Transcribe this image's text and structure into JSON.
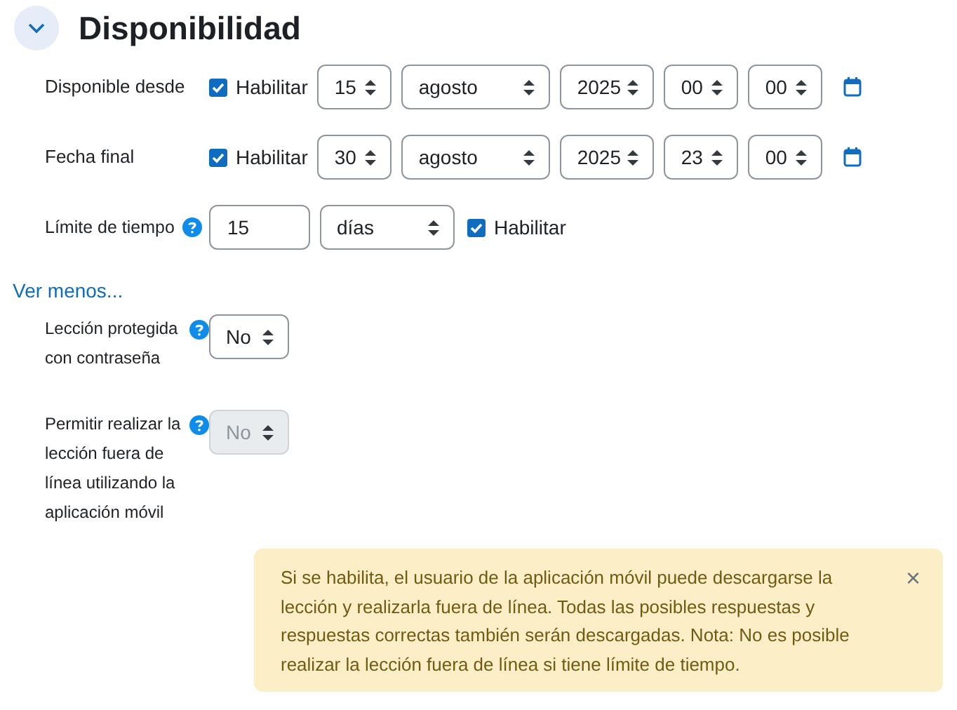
{
  "section": {
    "title": "Disponibilidad",
    "expanded": true
  },
  "date_rows": [
    {
      "label": "Disponible desde",
      "enable_label": "Habilitar",
      "enabled": true,
      "day": "15",
      "month": "agosto",
      "year": "2025",
      "hour": "00",
      "minute": "00"
    },
    {
      "label": "Fecha final",
      "enable_label": "Habilitar",
      "enabled": true,
      "day": "30",
      "month": "agosto",
      "year": "2025",
      "hour": "23",
      "minute": "00"
    }
  ],
  "time_limit": {
    "label": "Límite de tiempo",
    "value": "15",
    "unit": "días",
    "enable_label": "Habilitar",
    "enabled": true
  },
  "toggle_link": "Ver menos...",
  "options": [
    {
      "label": "Lección protegida con contraseña",
      "value": "No",
      "disabled": false
    },
    {
      "label": "Permitir realizar la lección fuera de línea utilizando la aplicación móvil",
      "value": "No",
      "disabled": true
    }
  ],
  "alert": {
    "text": "Si se habilita, el usuario de la aplicación móvil puede descargarse la lección y realizarla fuera de línea. Todas las posibles respuestas y respuestas correctas también serán descargadas. Nota: No es posible realizar la lección fuera de línea si tiene límite de tiempo.",
    "close": "×"
  }
}
